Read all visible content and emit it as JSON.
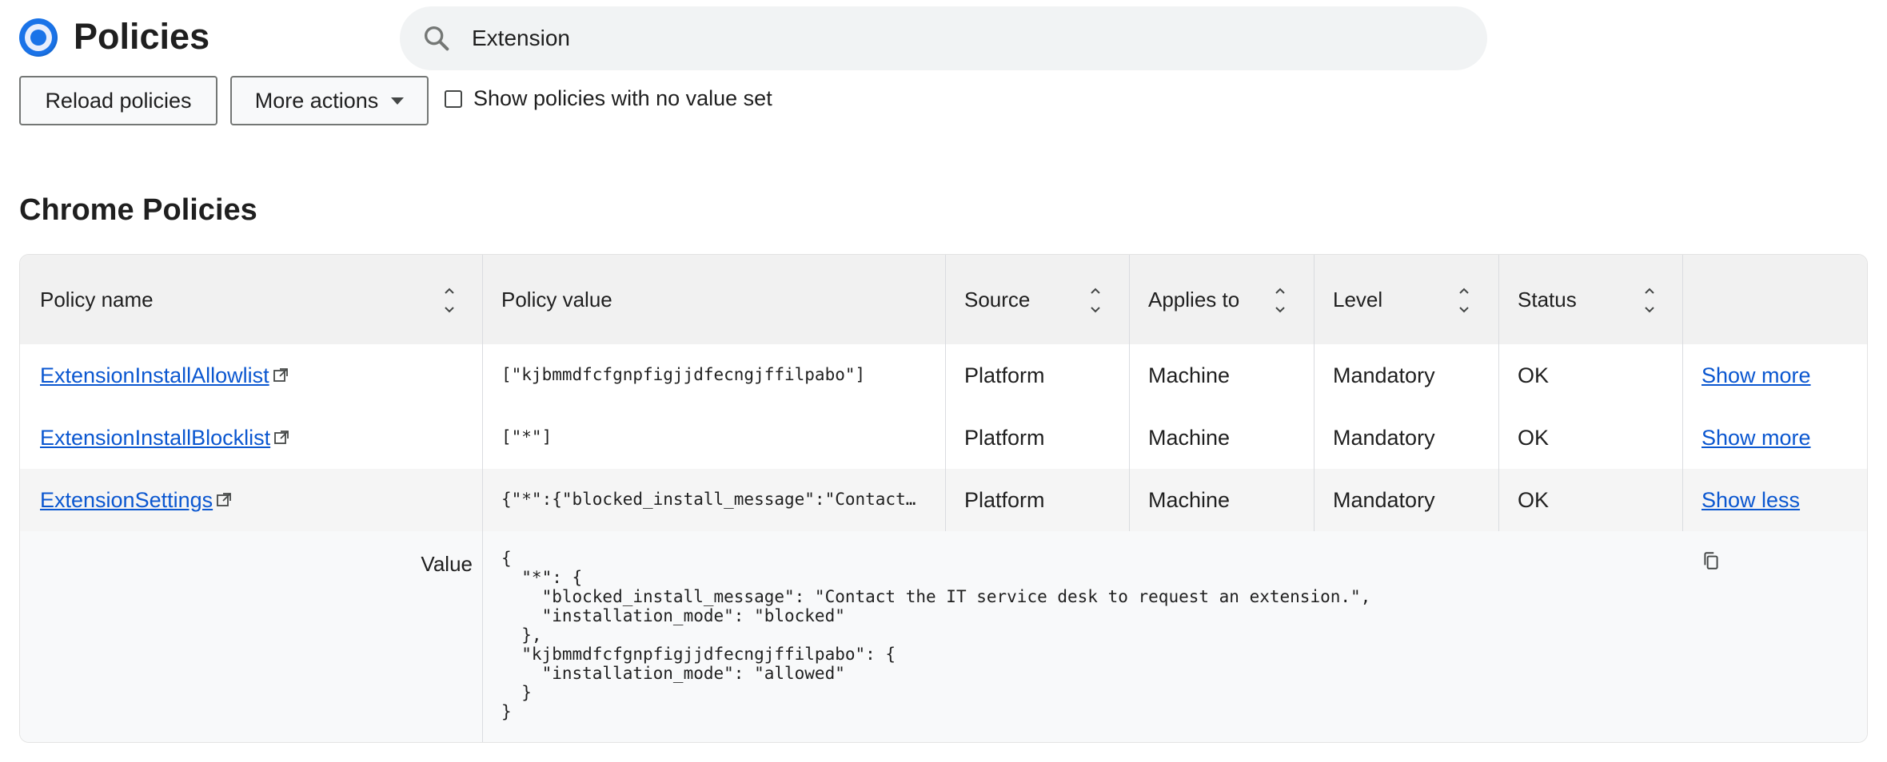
{
  "header": {
    "title": "Policies",
    "search": {
      "value": "Extension",
      "placeholder": ""
    }
  },
  "toolbar": {
    "reload_label": "Reload policies",
    "more_actions_label": "More actions",
    "show_unset_label": "Show policies with no value set",
    "show_unset_checked": false
  },
  "section": {
    "title": "Chrome Policies"
  },
  "table": {
    "columns": [
      "Policy name",
      "Policy value",
      "Source",
      "Applies to",
      "Level",
      "Status",
      ""
    ],
    "rows": [
      {
        "name": "ExtensionInstallAllowlist",
        "value": "[\"kjbmmdfcfgnpfigjjdfecngjffilpabo\"]",
        "source": "Platform",
        "applies_to": "Machine",
        "level": "Mandatory",
        "status": "OK",
        "toggle": "Show more"
      },
      {
        "name": "ExtensionInstallBlocklist",
        "value": "[\"*\"]",
        "source": "Platform",
        "applies_to": "Machine",
        "level": "Mandatory",
        "status": "OK",
        "toggle": "Show more"
      },
      {
        "name": "ExtensionSettings",
        "value": "{\"*\":{\"blocked_install_message\":\"Contact…",
        "source": "Platform",
        "applies_to": "Machine",
        "level": "Mandatory",
        "status": "OK",
        "toggle": "Show less"
      }
    ],
    "expanded": {
      "label": "Value",
      "json": "{\n  \"*\": {\n    \"blocked_install_message\": \"Contact the IT service desk to request an extension.\",\n    \"installation_mode\": \"blocked\"\n  },\n  \"kjbmmdfcfgnpfigjjdfecngjffilpabo\": {\n    \"installation_mode\": \"allowed\"\n  }\n}"
    }
  },
  "colors": {
    "link": "#0b57d0",
    "header_bg": "#f1f1f1",
    "brand_blue": "#1a73e8"
  }
}
